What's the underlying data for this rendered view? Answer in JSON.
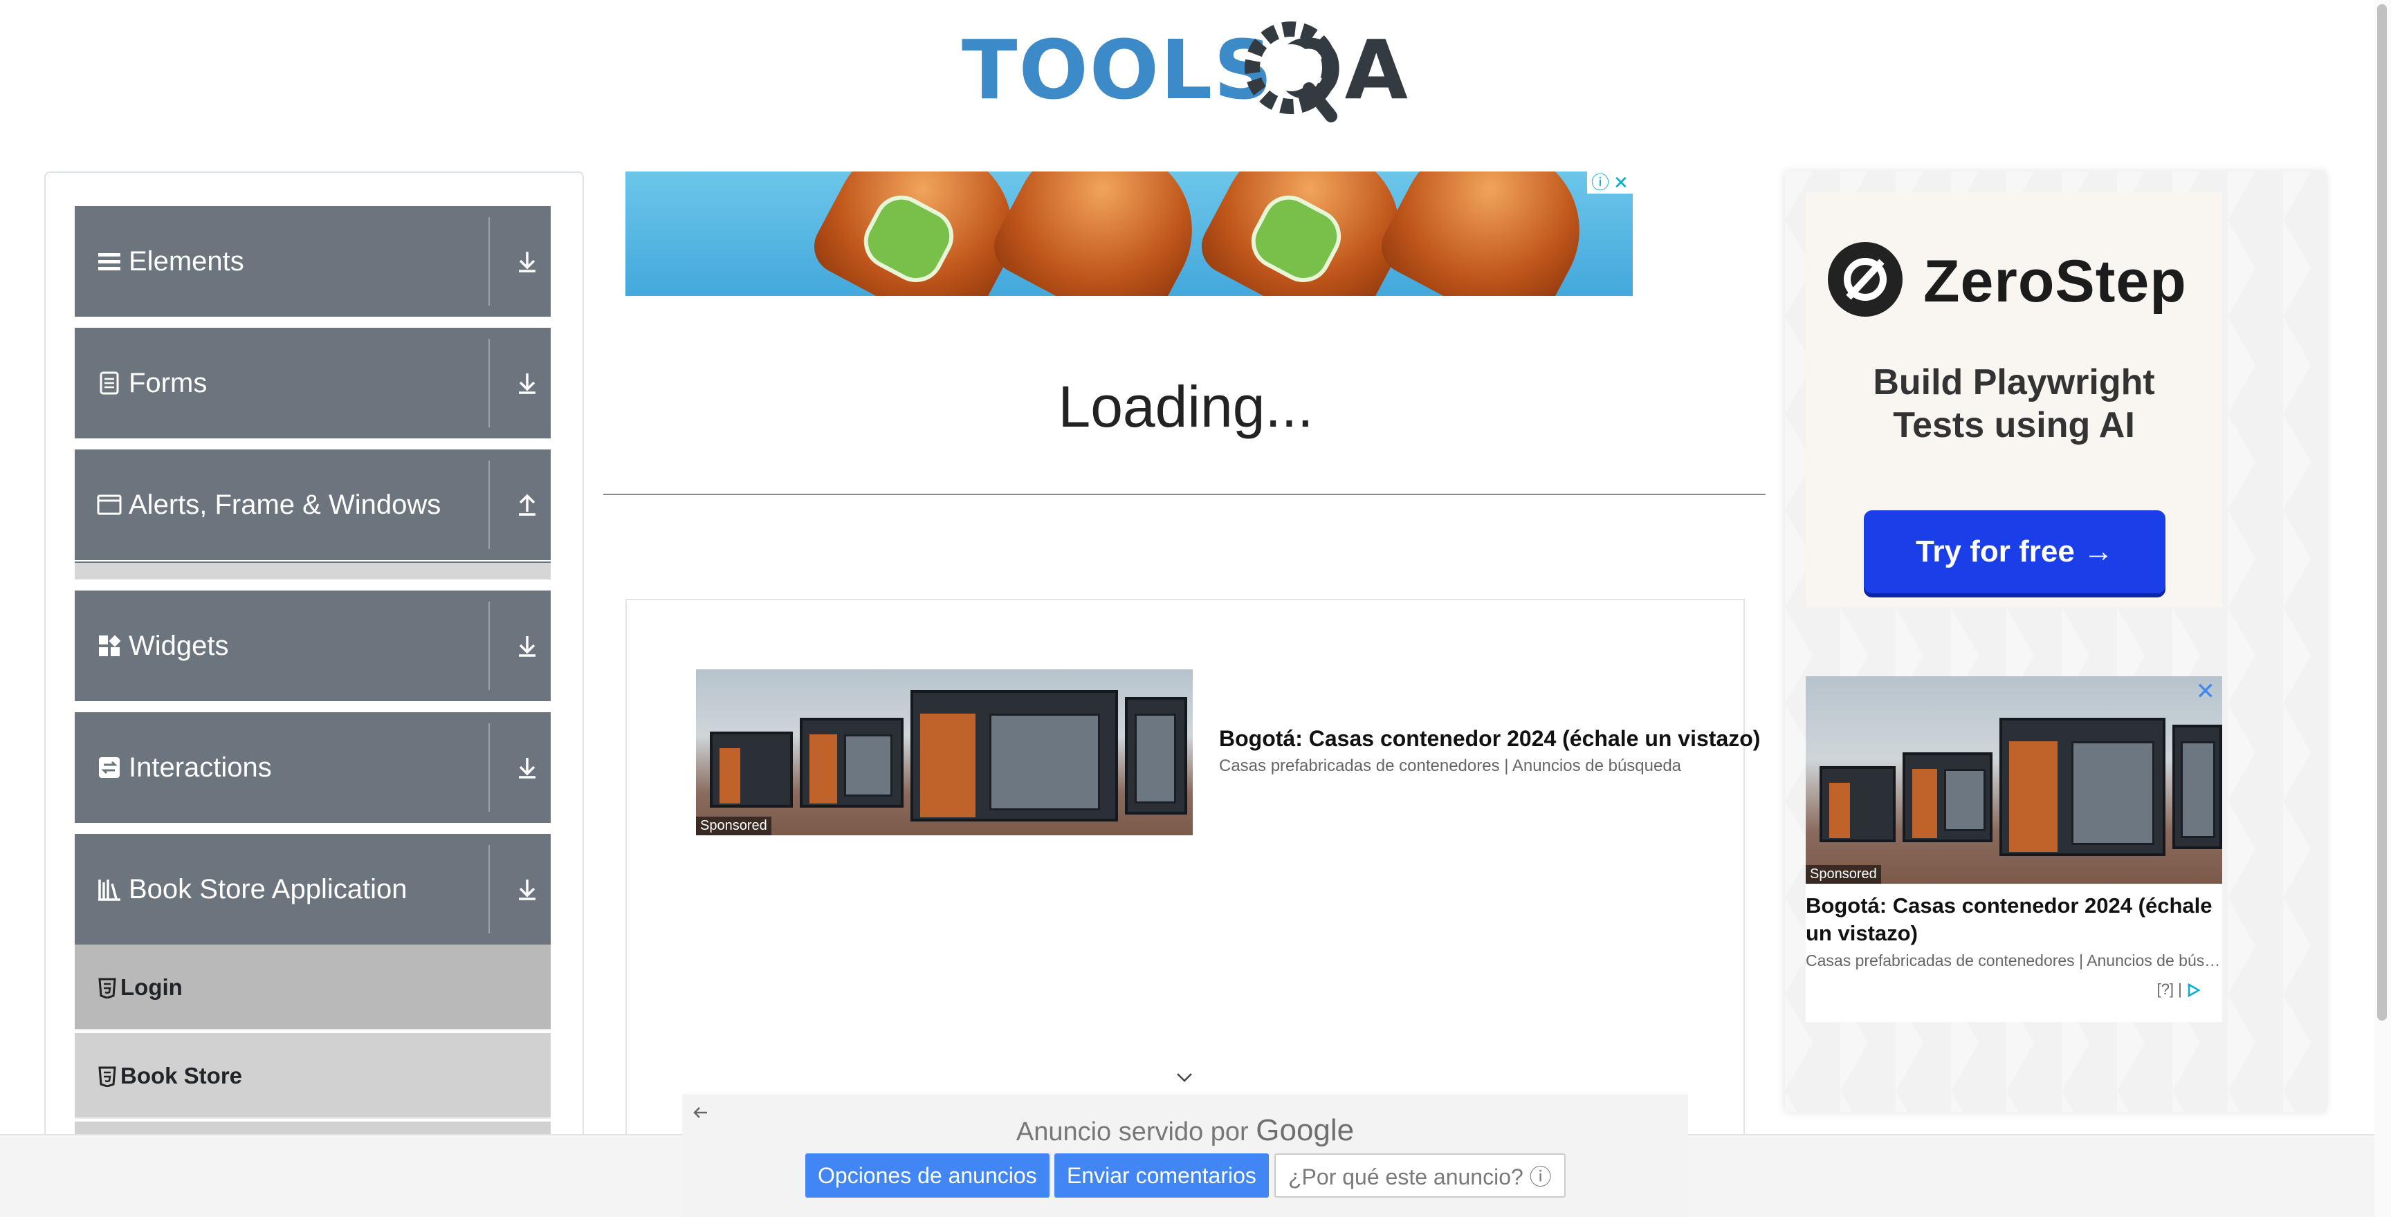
{
  "header": {
    "logo_part1": "TOOLS",
    "logo_part2": "QA"
  },
  "sidebar": {
    "groups": [
      {
        "label": "Elements",
        "icon": "hamburger-icon",
        "arrow": "down"
      },
      {
        "label": "Forms",
        "icon": "document-icon",
        "arrow": "down"
      },
      {
        "label": "Alerts, Frame & Windows",
        "icon": "window-icon",
        "arrow": "up"
      },
      {
        "label": "Widgets",
        "icon": "widgets-icon",
        "arrow": "down"
      },
      {
        "label": "Interactions",
        "icon": "interactions-icon",
        "arrow": "down"
      },
      {
        "label": "Book Store Application",
        "icon": "library-icon",
        "arrow": "down"
      }
    ],
    "book_store_items": [
      {
        "label": "Login"
      },
      {
        "label": "Book Store"
      }
    ]
  },
  "main": {
    "loading_text": "Loading...",
    "native_ad": {
      "title": "Bogotá: Casas contenedor 2024 (échale un vistazo)",
      "subtitle": "Casas prefabricadas de contenedores | Anuncios de búsqueda",
      "sponsored": "Sponsored"
    },
    "google_bar": {
      "served_by": "Anuncio servido por",
      "google": "Google",
      "options_button": "Opciones de anuncios",
      "feedback_button": "Enviar comentarios",
      "why_button": "¿Por qué este anuncio? ⓘ"
    }
  },
  "right_ads": {
    "zerostep": {
      "name": "ZeroStep",
      "tagline_line1": "Build Playwright",
      "tagline_line2": "Tests using AI",
      "cta": "Try for free →"
    },
    "house_ad": {
      "sponsored": "Sponsored",
      "title": "Bogotá: Casas contenedor 2024 (échale un vistazo)",
      "subtitle": "Casas prefabricadas de contenedores | Anuncios de búsqueda",
      "help": "[?] |"
    }
  },
  "colors": {
    "sidebar_group_bg": "#6c757d",
    "toolsqa_blue": "#3d8ac8",
    "cta_blue": "#1a3ee8",
    "google_blue": "#4285f4"
  }
}
